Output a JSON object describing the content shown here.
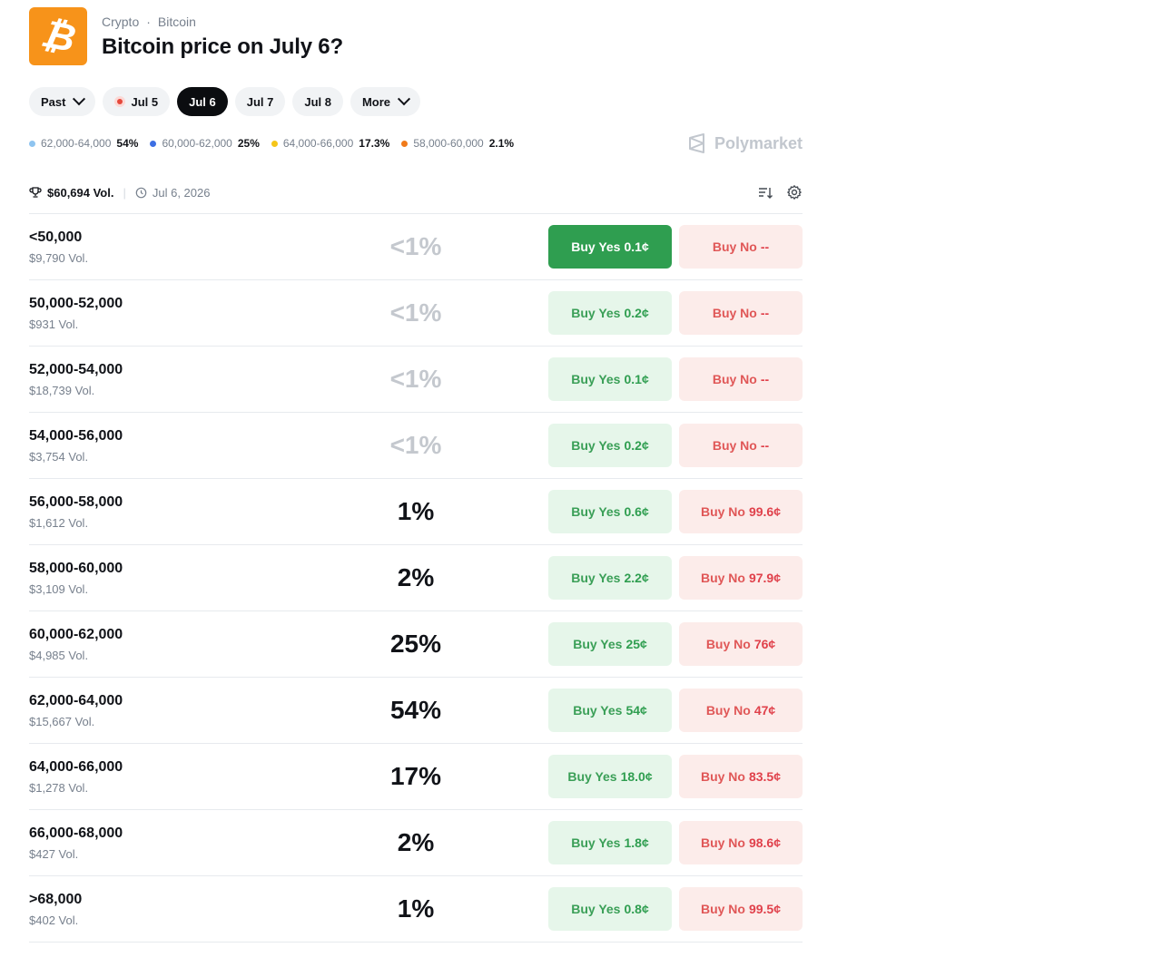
{
  "header": {
    "logo_glyph": "₿",
    "breadcrumb": [
      "Crypto",
      "Bitcoin"
    ],
    "breadcrumb_sep": "·",
    "title": "Bitcoin price on July 6?"
  },
  "tabs": [
    {
      "label": "Past",
      "has_chevron": true,
      "active": false,
      "live": false
    },
    {
      "label": "Jul 5",
      "has_chevron": false,
      "active": false,
      "live": true
    },
    {
      "label": "Jul 6",
      "has_chevron": false,
      "active": true,
      "live": false
    },
    {
      "label": "Jul 7",
      "has_chevron": false,
      "active": false,
      "live": false
    },
    {
      "label": "Jul 8",
      "has_chevron": false,
      "active": false,
      "live": false
    },
    {
      "label": "More",
      "has_chevron": true,
      "active": false,
      "live": false
    }
  ],
  "legend": [
    {
      "label": "62,000-64,000",
      "pct": "54%",
      "color": "#8ec4f0"
    },
    {
      "label": "60,000-62,000",
      "pct": "25%",
      "color": "#3d6fe3"
    },
    {
      "label": "64,000-66,000",
      "pct": "17.3%",
      "color": "#f5c518"
    },
    {
      "label": "58,000-60,000",
      "pct": "2.1%",
      "color": "#f07a1a"
    }
  ],
  "brand": "Polymarket",
  "meta": {
    "volume": "$60,694 Vol.",
    "date": "Jul 6, 2026",
    "icons": [
      "trophy-icon",
      "clock-icon",
      "sort-icon",
      "gear-icon"
    ]
  },
  "markets": [
    {
      "name": "<50,000",
      "volume": "$9,790 Vol.",
      "chance": "<1%",
      "faint": true,
      "yes_label": "Buy Yes",
      "yes_price": "0.1¢",
      "no_label": "Buy No",
      "no_price": "--",
      "highlight": true
    },
    {
      "name": "50,000-52,000",
      "volume": "$931 Vol.",
      "chance": "<1%",
      "faint": true,
      "yes_label": "Buy Yes",
      "yes_price": "0.2¢",
      "no_label": "Buy No",
      "no_price": "--",
      "highlight": false
    },
    {
      "name": "52,000-54,000",
      "volume": "$18,739 Vol.",
      "chance": "<1%",
      "faint": true,
      "yes_label": "Buy Yes",
      "yes_price": "0.1¢",
      "no_label": "Buy No",
      "no_price": "--",
      "highlight": false
    },
    {
      "name": "54,000-56,000",
      "volume": "$3,754 Vol.",
      "chance": "<1%",
      "faint": true,
      "yes_label": "Buy Yes",
      "yes_price": "0.2¢",
      "no_label": "Buy No",
      "no_price": "--",
      "highlight": false
    },
    {
      "name": "56,000-58,000",
      "volume": "$1,612 Vol.",
      "chance": "1%",
      "faint": false,
      "yes_label": "Buy Yes",
      "yes_price": "0.6¢",
      "no_label": "Buy No",
      "no_price": "99.6¢",
      "highlight": false
    },
    {
      "name": "58,000-60,000",
      "volume": "$3,109 Vol.",
      "chance": "2%",
      "faint": false,
      "yes_label": "Buy Yes",
      "yes_price": "2.2¢",
      "no_label": "Buy No",
      "no_price": "97.9¢",
      "highlight": false
    },
    {
      "name": "60,000-62,000",
      "volume": "$4,985 Vol.",
      "chance": "25%",
      "faint": false,
      "yes_label": "Buy Yes",
      "yes_price": "25¢",
      "no_label": "Buy No",
      "no_price": "76¢",
      "highlight": false
    },
    {
      "name": "62,000-64,000",
      "volume": "$15,667 Vol.",
      "chance": "54%",
      "faint": false,
      "yes_label": "Buy Yes",
      "yes_price": "54¢",
      "no_label": "Buy No",
      "no_price": "47¢",
      "highlight": false
    },
    {
      "name": "64,000-66,000",
      "volume": "$1,278 Vol.",
      "chance": "17%",
      "faint": false,
      "yes_label": "Buy Yes",
      "yes_price": "18.0¢",
      "no_label": "Buy No",
      "no_price": "83.5¢",
      "highlight": false
    },
    {
      "name": "66,000-68,000",
      "volume": "$427 Vol.",
      "chance": "2%",
      "faint": false,
      "yes_label": "Buy Yes",
      "yes_price": "1.8¢",
      "no_label": "Buy No",
      "no_price": "98.6¢",
      "highlight": false
    },
    {
      "name": ">68,000",
      "volume": "$402 Vol.",
      "chance": "1%",
      "faint": false,
      "yes_label": "Buy Yes",
      "yes_price": "0.8¢",
      "no_label": "Buy No",
      "no_price": "99.5¢",
      "highlight": false
    }
  ]
}
